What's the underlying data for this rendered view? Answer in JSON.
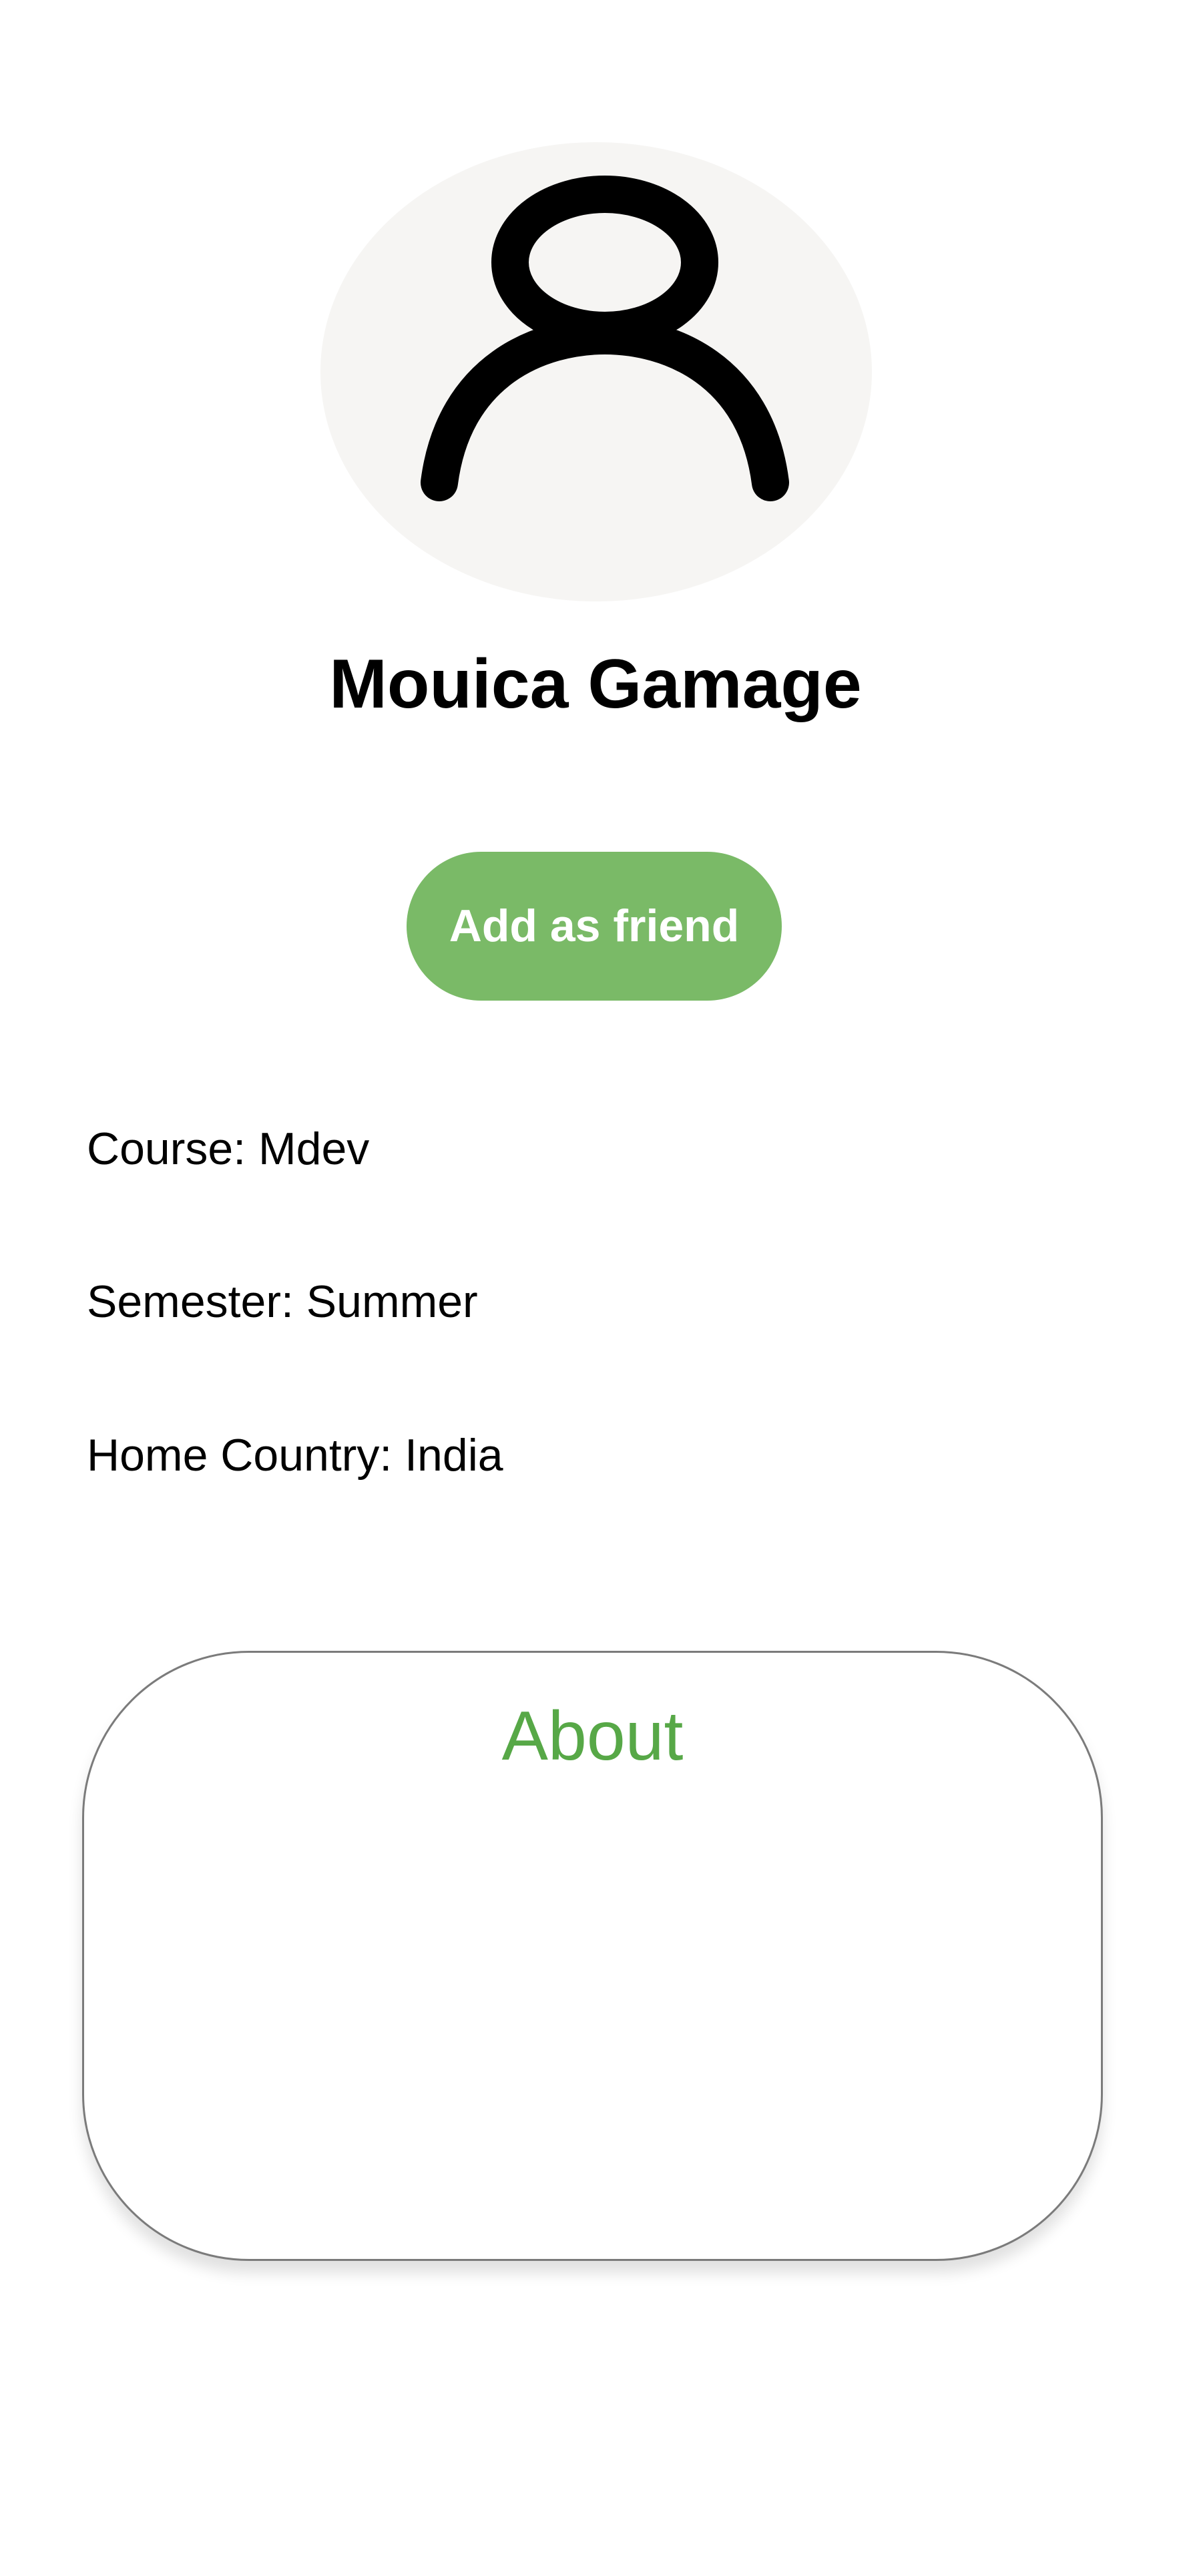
{
  "profile": {
    "avatar_icon": "user-silhouette-icon",
    "name": "Mouica Gamage"
  },
  "actions": {
    "add_friend_label": "Add as friend"
  },
  "info": {
    "course": "Course: Mdev",
    "semester": "Semester: Summer",
    "home_country": "Home Country: India"
  },
  "about": {
    "title": "About"
  },
  "colors": {
    "accent": "#7aba67",
    "about_title": "#57a847",
    "avatar_bg": "#f6f5f3",
    "text": "#000000"
  }
}
